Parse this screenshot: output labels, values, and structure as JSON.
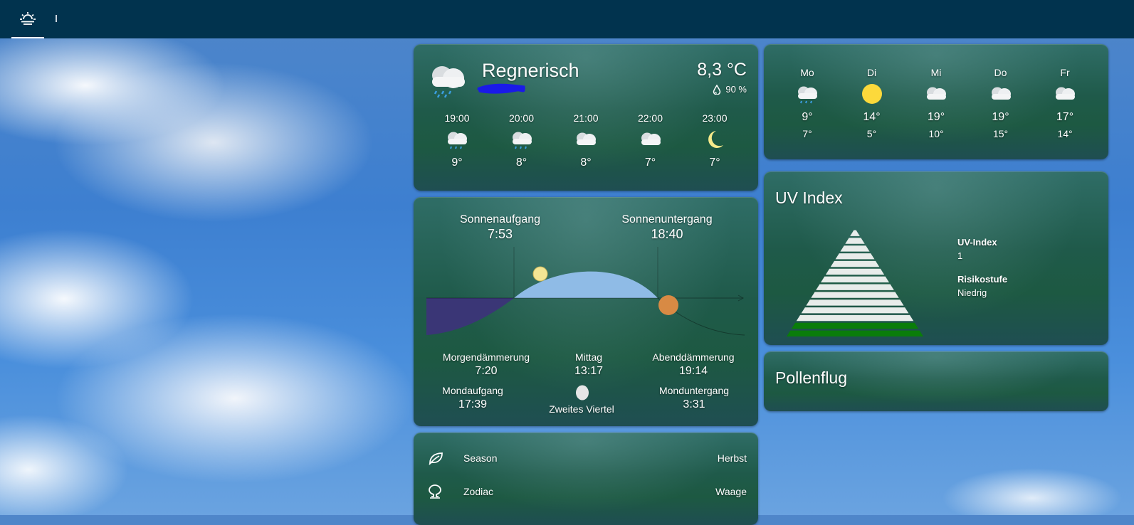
{
  "topbar": {
    "tabs": [
      {
        "icon": "sunrise-icon",
        "active": true
      },
      {
        "icon": "tab-separator-icon",
        "active": false
      }
    ]
  },
  "current": {
    "condition": "Regnerisch",
    "temperature": "8,3 °C",
    "humidity": "90 %",
    "hourly": [
      {
        "time": "19:00",
        "icon": "rain-cloud-icon",
        "temp": "9°"
      },
      {
        "time": "20:00",
        "icon": "rain-cloud-icon",
        "temp": "8°"
      },
      {
        "time": "21:00",
        "icon": "cloud-icon",
        "temp": "8°"
      },
      {
        "time": "22:00",
        "icon": "cloud-icon",
        "temp": "7°"
      },
      {
        "time": "23:00",
        "icon": "moon-icon",
        "temp": "7°"
      }
    ]
  },
  "sun": {
    "sunrise_label": "Sonnenaufgang",
    "sunrise": "7:53",
    "sunset_label": "Sonnenuntergang",
    "sunset": "18:40",
    "dawn_label": "Morgendämmerung",
    "dawn": "7:20",
    "noon_label": "Mittag",
    "noon": "13:17",
    "dusk_label": "Abenddämmerung",
    "dusk": "19:14",
    "moonrise_label": "Mondaufgang",
    "moonrise": "17:39",
    "moon_phase": "Zweites Viertel",
    "moonset_label": "Monduntergang",
    "moonset": "3:31"
  },
  "attributes": [
    {
      "icon": "leaf-icon",
      "label": "Season",
      "value": "Herbst"
    },
    {
      "icon": "omega-icon",
      "label": "Zodiac",
      "value": "Waage"
    }
  ],
  "forecast": [
    {
      "day": "Mo",
      "icon": "rain-cloud-icon",
      "high": "9°",
      "low": "7°"
    },
    {
      "day": "Di",
      "icon": "sun-icon",
      "high": "14°",
      "low": "5°"
    },
    {
      "day": "Mi",
      "icon": "cloud-icon",
      "high": "19°",
      "low": "10°"
    },
    {
      "day": "Do",
      "icon": "cloud-icon",
      "high": "19°",
      "low": "15°"
    },
    {
      "day": "Fr",
      "icon": "cloud-icon",
      "high": "17°",
      "low": "14°"
    }
  ],
  "uv": {
    "title": "UV Index",
    "index_label": "UV-Index",
    "index_value": "1",
    "risk_label": "Risikostufe",
    "risk_value": "Niedrig",
    "colors": {
      "active": "#0a7d0a",
      "inactive": "#e8ecea"
    }
  },
  "pollen": {
    "title": "Pollenflug"
  }
}
